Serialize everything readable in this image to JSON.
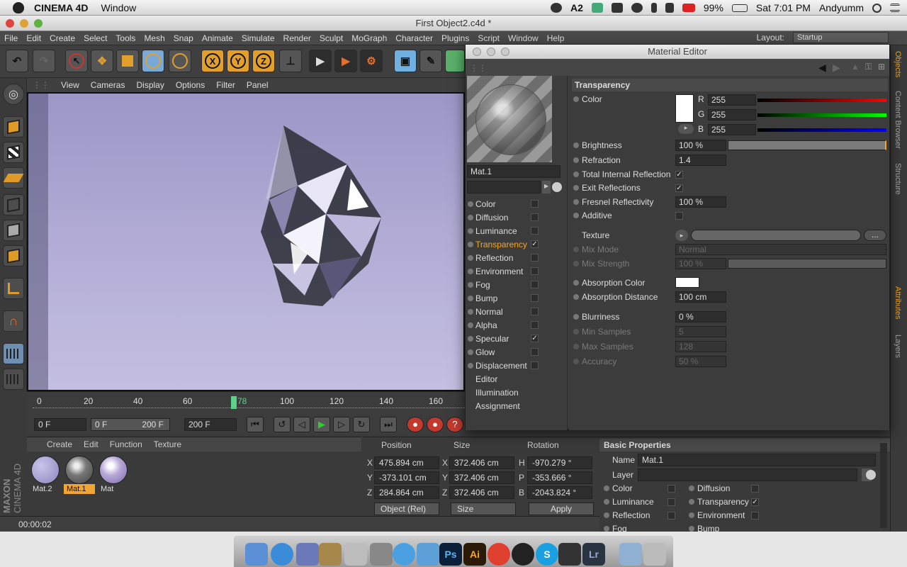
{
  "mac_menubar": {
    "app_name": "CINEMA 4D",
    "menu": "Window",
    "status_number": "2",
    "battery": "99%",
    "clock": "Sat 7:01 PM",
    "user": "Andyumm"
  },
  "window": {
    "title": "First Object2.c4d *"
  },
  "app_menu": {
    "items": [
      "File",
      "Edit",
      "Create",
      "Select",
      "Tools",
      "Mesh",
      "Snap",
      "Animate",
      "Simulate",
      "Render",
      "Sculpt",
      "MoGraph",
      "Character",
      "Plugins",
      "Script",
      "Window",
      "Help"
    ],
    "layout_label": "Layout:",
    "layout_value": "Startup"
  },
  "toolbar": {
    "axis_x": "X",
    "axis_y": "Y",
    "axis_z": "Z"
  },
  "viewport_menu": {
    "items": [
      "View",
      "Cameras",
      "Display",
      "Options",
      "Filter",
      "Panel"
    ]
  },
  "timeline": {
    "ticks": [
      "0",
      "20",
      "40",
      "60",
      "78",
      "100",
      "120",
      "140",
      "160"
    ],
    "current_frame": "78"
  },
  "transport": {
    "start_field": "0 F",
    "range_start": "0 F",
    "range_end": "200 F",
    "end_field": "200 F"
  },
  "material_manager": {
    "menu": [
      "Create",
      "Edit",
      "Function",
      "Texture"
    ],
    "materials": [
      {
        "name": "Mat.2",
        "selected": false
      },
      {
        "name": "Mat.1",
        "selected": true
      },
      {
        "name": "Mat",
        "selected": false
      }
    ]
  },
  "coordinates": {
    "headers": {
      "position": "Position",
      "size": "Size",
      "rotation": "Rotation"
    },
    "rows": [
      {
        "axis": "X",
        "pos": "475.894 cm",
        "size_axis": "X",
        "size": "372.406 cm",
        "rot_axis": "H",
        "rot": "-970.279 °"
      },
      {
        "axis": "Y",
        "pos": "-373.101 cm",
        "size_axis": "Y",
        "size": "372.406 cm",
        "rot_axis": "P",
        "rot": "-353.666 °"
      },
      {
        "axis": "Z",
        "pos": "284.864 cm",
        "size_axis": "Z",
        "size": "372.406 cm",
        "rot_axis": "B",
        "rot": "-2043.824 °"
      }
    ],
    "mode": "Object (Rel)",
    "size_mode": "Size",
    "apply": "Apply"
  },
  "status_bar": {
    "time": "00:00:02"
  },
  "material_editor": {
    "title": "Material Editor",
    "material_name": "Mat.1",
    "channels": [
      {
        "name": "Color",
        "checked": false
      },
      {
        "name": "Diffusion",
        "checked": false
      },
      {
        "name": "Luminance",
        "checked": false
      },
      {
        "name": "Transparency",
        "checked": true,
        "active": true
      },
      {
        "name": "Reflection",
        "checked": false
      },
      {
        "name": "Environment",
        "checked": false
      },
      {
        "name": "Fog",
        "checked": false
      },
      {
        "name": "Bump",
        "checked": false
      },
      {
        "name": "Normal",
        "checked": false
      },
      {
        "name": "Alpha",
        "checked": false
      },
      {
        "name": "Specular",
        "checked": true
      },
      {
        "name": "Glow",
        "checked": false
      },
      {
        "name": "Displacement",
        "checked": false
      }
    ],
    "extra": [
      "Editor",
      "Illumination",
      "Assignment"
    ],
    "section": "Transparency",
    "color_label": "Color",
    "r_label": "R",
    "r": "255",
    "g_label": "G",
    "g": "255",
    "b_label": "B",
    "b": "255",
    "brightness_label": "Brightness",
    "brightness": "100 %",
    "refraction_label": "Refraction",
    "refraction": "1.4",
    "tir_label": "Total Internal Reflection",
    "exit_label": "Exit Reflections",
    "fresnel_label": "Fresnel Reflectivity",
    "fresnel": "100 %",
    "additive_label": "Additive",
    "texture_label": "Texture",
    "texture_btn": "...",
    "mixmode_label": "Mix Mode",
    "mixmode": "Normal",
    "mixstrength_label": "Mix Strength",
    "mixstrength": "100 %",
    "abscolor_label": "Absorption Color",
    "absdist_label": "Absorption Distance",
    "absdist": "100 cm",
    "blur_label": "Blurriness",
    "blur": "0 %",
    "minsamp_label": "Min Samples",
    "minsamp": "5",
    "maxsamp_label": "Max Samples",
    "maxsamp": "128",
    "accuracy_label": "Accuracy",
    "accuracy": "50 %"
  },
  "attributes": {
    "section": "Basic Properties",
    "name_label": "Name",
    "name": "Mat.1",
    "layer_label": "Layer",
    "channels": [
      {
        "name": "Color",
        "checked": false
      },
      {
        "name": "Diffusion",
        "checked": false
      },
      {
        "name": "Luminance",
        "checked": false
      },
      {
        "name": "Transparency",
        "checked": true
      },
      {
        "name": "Reflection",
        "checked": false
      },
      {
        "name": "Environment",
        "checked": false
      },
      {
        "name": "Fog",
        "checked": false
      },
      {
        "name": "Bump",
        "checked": false
      }
    ]
  },
  "right_tabs": [
    "Objects",
    "Content Browser",
    "Structure",
    "Attributes",
    "Layers"
  ],
  "left_brand": {
    "line1": "MAXON",
    "line2": "CINEMA 4D"
  },
  "dock": {
    "ps": "Ps",
    "ai": "Ai",
    "lr": "Lr"
  },
  "colors": {
    "accent": "#f5a623",
    "panel": "#3c3c3c"
  }
}
